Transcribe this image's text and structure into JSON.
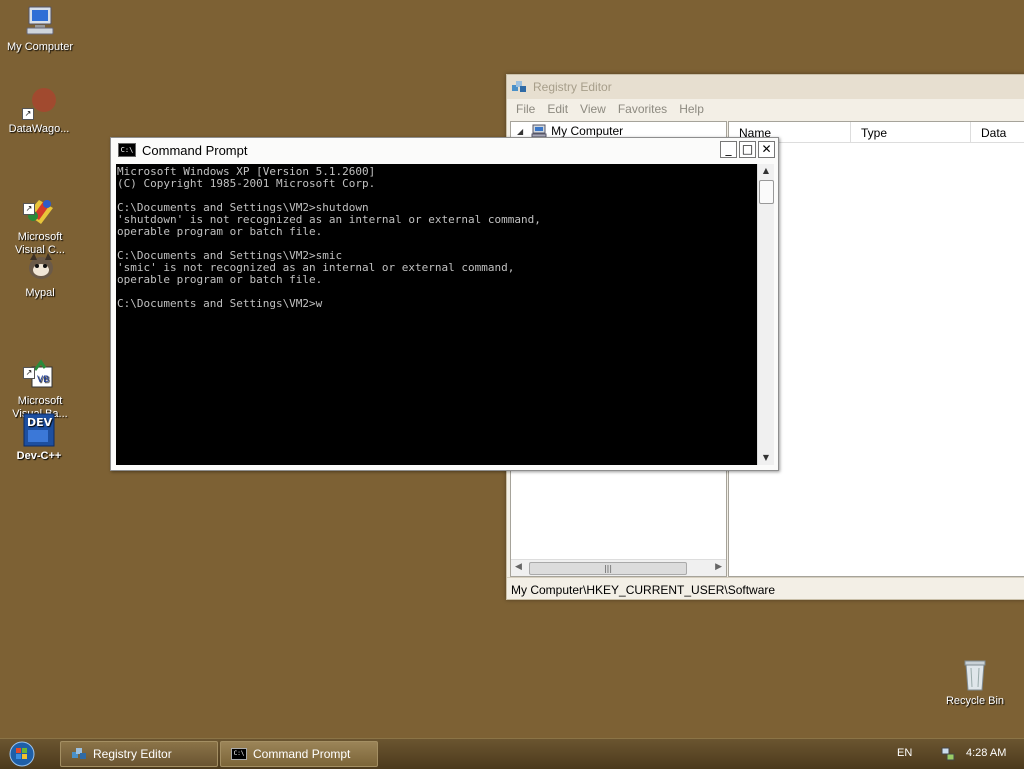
{
  "desktop": {
    "icons": [
      {
        "label": "My Computer",
        "icon": "my-computer-icon"
      },
      {
        "label": "DataWago...",
        "icon": "datawago-icon"
      },
      {
        "label": "Microsoft\nVisual C...",
        "icon": "visual-c-icon"
      },
      {
        "label": "Mypal",
        "icon": "mypal-icon"
      },
      {
        "label": "Microsoft\nVisual Ba...",
        "icon": "visual-basic-icon"
      },
      {
        "label": "Dev-C++",
        "icon": "dev-cpp-icon"
      },
      {
        "label": "Recycle Bin",
        "icon": "recycle-bin-icon"
      }
    ]
  },
  "registry_editor": {
    "title": "Registry Editor",
    "menu": [
      "File",
      "Edit",
      "View",
      "Favorites",
      "Help"
    ],
    "tree_root": "My Computer",
    "columns": [
      "Name",
      "Type",
      "Data"
    ],
    "status": "My Computer\\HKEY_CURRENT_USER\\Software"
  },
  "command_prompt": {
    "title": "Command Prompt",
    "icon_text": "C:\\",
    "buttons": {
      "minimize": "_",
      "maximize": "□",
      "close": "✕"
    },
    "lines": [
      "Microsoft Windows XP [Version 5.1.2600]",
      "(C) Copyright 1985-2001 Microsoft Corp.",
      "",
      "C:\\Documents and Settings\\VM2>shutdown",
      "'shutdown' is not recognized as an internal or external command,",
      "operable program or batch file.",
      "",
      "C:\\Documents and Settings\\VM2>smic",
      "'smic' is not recognized as an internal or external command,",
      "operable program or batch file.",
      "",
      "C:\\Documents and Settings\\VM2>w"
    ]
  },
  "taskbar": {
    "buttons": [
      {
        "label": "Registry Editor",
        "icon": "registry-icon"
      },
      {
        "label": "Command Prompt",
        "icon": "cmd-icon"
      }
    ],
    "language": "EN",
    "clock": "4:28 AM"
  },
  "colors": {
    "desktop": "#7d6134",
    "console_bg": "#000000",
    "console_fg": "#c0c0c0",
    "taskbar": "#5a4526"
  }
}
